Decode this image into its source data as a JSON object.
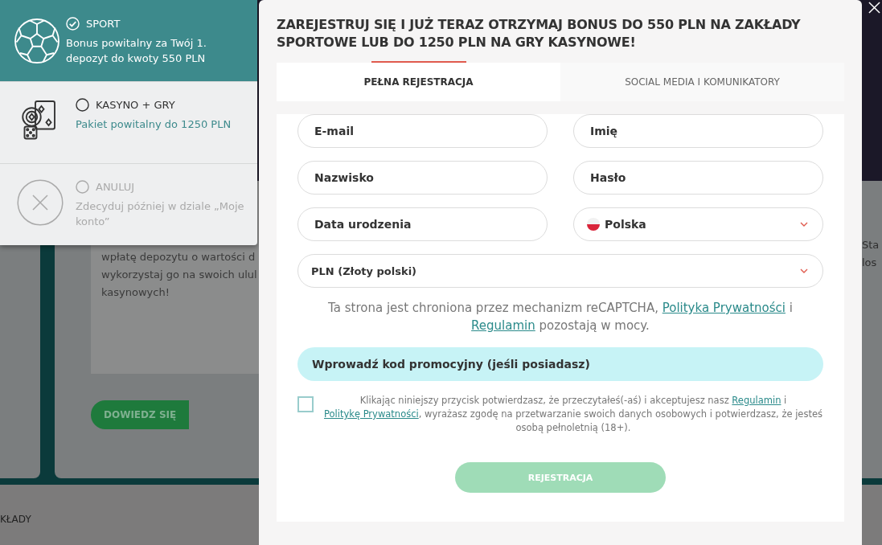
{
  "background": {
    "card_lines": [
      "wpłatę depozytu o wartości d",
      "wykorzystaj go na swoich ulul",
      "kasynowych!"
    ],
    "card_button": "DOWIEDZ SIĘ",
    "footer_heading": "KŁADY",
    "right_lines": [
      "Sta",
      "los"
    ]
  },
  "bonus_options": [
    {
      "kind": "ball",
      "title": "SPORT",
      "description": "Bonus powitalny za Twój 1. depozyt do kwoty 550 PLN",
      "selected": true
    },
    {
      "kind": "cards",
      "title": "KASYNO + GRY",
      "description": "Pakiet powitalny do 1250 PLN",
      "selected": false
    },
    {
      "kind": "cancel",
      "title": "ANULUJ",
      "description": "Zdecyduj później w dziale „Moje konto”",
      "selected": false
    }
  ],
  "modal": {
    "title": "ZAREJESTRUJ SIĘ I JUŻ TERAZ OTRZYMAJ BONUS DO 550 PLN NA ZAKŁADY SPORTOWE LUB DO 1250 PLN NA GRY KASYNOWE!",
    "tabs": [
      {
        "label": "PEŁNA REJESTRACJA",
        "selected": true
      },
      {
        "label": "SOCIAL MEDIA I KOMUNIKATORY",
        "selected": false
      }
    ],
    "fields": [
      {
        "kind": "input",
        "placeholder": "E-mail"
      },
      {
        "kind": "input",
        "placeholder": "Imię"
      },
      {
        "kind": "input",
        "placeholder": "Nazwisko"
      },
      {
        "kind": "input",
        "placeholder": "Hasło"
      },
      {
        "kind": "input",
        "placeholder": "Data urodzenia"
      },
      {
        "kind": "country",
        "value": "Polska"
      },
      {
        "kind": "currency",
        "value": "PLN (Złoty polski)"
      }
    ],
    "recaptcha": [
      {
        "text": "Ta strona jest chroniona przez mechanizm reCAPTCHA, ",
        "link": false
      },
      {
        "text": "Polityka Prywatności",
        "link": true
      },
      {
        "text": " i ",
        "link": false
      },
      {
        "text": "Regulamin",
        "link": true
      },
      {
        "text": " pozostają w mocy.",
        "link": false
      }
    ],
    "promo": "Wprowadź kod promocyjny (jeśli posiadasz)",
    "consent": {
      "checked": false,
      "segments": [
        {
          "text": "Klikając niniejszy przycisk potwierdzasz, że przeczytałeś(-aś) i akceptujesz nasz ",
          "link": false
        },
        {
          "text": "Regulamin",
          "link": true
        },
        {
          "text": " i ",
          "link": false
        },
        {
          "text": "Politykę Prywatności",
          "link": true
        },
        {
          "text": ", wyrażasz zgodę na przetwarzanie swoich danych osobowych i potwierdzasz, że jesteś osobą pełnoletnią (18+).",
          "link": false
        }
      ]
    },
    "register": {
      "label": "REJESTRACJA",
      "disabled": true
    }
  }
}
